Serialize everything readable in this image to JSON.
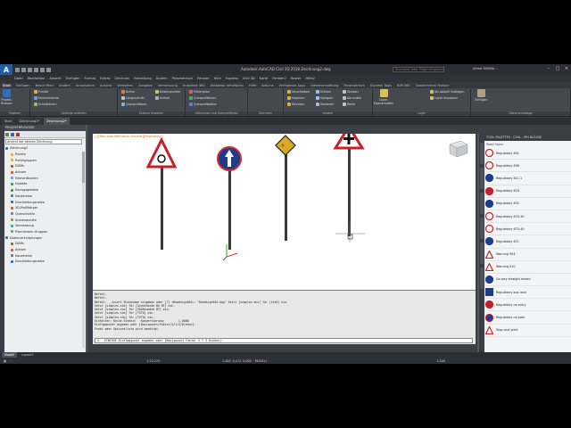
{
  "title": {
    "window": "Autodesk AutoCAD Civil 3D 2018    Zeichnung2.dwg",
    "search_placeholder": "Stichwort oder Frage eingeben",
    "user": "Alfred WEBINI..."
  },
  "menubar": [
    "Datei",
    "Bearbeiten",
    "Ansicht",
    "Einfügen",
    "Format",
    "Extras",
    "Zeichnen",
    "Bemaßung",
    "Ändern",
    "Parametrisch",
    "Fenster",
    "Hilfe",
    "Express",
    "Civil 3D",
    "Karte",
    "Fenster2",
    "Raster",
    "Hilfe2"
  ],
  "ribbon_tabs": [
    "Start",
    "Einfügen",
    "Beschriften",
    "Ändern",
    "Analysieren",
    "Ansicht",
    "Verwalten",
    "Ausgabe",
    "Vermessung",
    "Autodesk 360",
    "Autodesk InfraWorks",
    "Hilfe",
    "Add-ins",
    "Verfügbare Apps",
    "Datenverwaltung",
    "Parametrisch",
    "Express Tools",
    "BIM 360",
    "Geotechnical Module"
  ],
  "ribbon": {
    "prospector_btn": "Projekt-Browser",
    "palettes_group": "Paletten",
    "groups": [
      "Gelände erstellen",
      "Entwurf erstellen",
      "Höhenplan und Querprofilplan",
      "Zeichnen",
      "Ändern",
      "Layer",
      "Zwischenablage"
    ],
    "rows": [
      [
        "Punkte",
        "Elementkante",
        "Schnittlinien",
        "Achse",
        "Längsschnitt",
        "Querprofilplan",
        "Knotenpunkte",
        "Kreisel",
        "Höhenplan",
        "Querprofillinien",
        "Querprofilpläne"
      ],
      [
        "Verschieben",
        "Kopieren",
        "Strecken",
        "Drehen",
        "Spiegeln",
        "Skalieren",
        "Stutzen",
        "Abrunden",
        "Reihe"
      ]
    ],
    "layer_items": [
      "Als aktuell festlegen",
      "Layer anpassen"
    ],
    "paste": "Einfügen",
    "layer_props": "Layer-Eigenschaften"
  },
  "doc_tabs": [
    "Start",
    "Zeichnung1*",
    "Zeichnung2*"
  ],
  "prospector": {
    "header": "PROJEKTBROWSER",
    "select": "Ansicht der aktiven Zeichnung",
    "tree": [
      "Zeichnung2",
      "Punkte",
      "Punktgruppen",
      "DGMs",
      "Achsen",
      "Elementkanten",
      "Gebiete",
      "Einzugsgebiete",
      "Kanalnetze",
      "Druckleitungsnetze",
      "3D-Profilkörper",
      "Querschnitte",
      "Knotenpunkte",
      "Vermessung",
      "Planrahmen-Gruppen",
      "Datenverknüpfungen",
      "DGMs",
      "Achsen",
      "Kanalnetze",
      "Druckleitungsnetze"
    ]
  },
  "viewport": {
    "title": "[-][Benutzerdefinierte Ansicht][Realistisch]"
  },
  "command": {
    "lines": [
      "Befehl:",
      "Befehl:",
      "Befehl: _-insert Blockname eingeben oder [?] <Roadsign504>: \"Roadsign504.dwg\" Setzt [simplex.shx] für [txt0] ein.",
      "Setzt [simplex.shx] für [AvantGarde Bk BT] ein.",
      "Setzt [simplex.shx] für [VAGRounded BT] ein.",
      "Setzt [simplex.shx] für [TXTO] ein.",
      "Setzt [simplex.shx] für [TXT0] ein.",
      "Einheiten: Keine Einheit   Konvertierung:        1,0000",
      "Einfügepunkt angeben oder [Basispunkt/Faktor/X/Y/Z/Drehen]:",
      "Punkt oder Optionsliste wird benötigt."
    ],
    "input": "X- -EINFÜGE Einfügepunkt angeben oder [Basispunkt Faktor X Y Z Drehen]:"
  },
  "palette": {
    "header": "TOOL PALETTES - CIVIL - MH BLÖCKE",
    "section": "Road Signs",
    "items": [
      "Regulatory 601",
      "Regulatory 606",
      "Regulatory 611.1",
      "Regulatory 618",
      "Regulatory 632",
      "Regulatory 670-30",
      "Regulatory 670-40",
      "Regulatory 671",
      "Warning 904",
      "Warning 510",
      "Go way straight ahead",
      "Regulatory bus lane",
      "Regulatory no entry",
      "Regulatory no park",
      "Stop and yield"
    ]
  },
  "layout_tabs": [
    "Modell",
    "Layout1"
  ],
  "status": {
    "scale": "1:25.225",
    "coords": "2,000, 0,472, 0,000",
    "space": "MODELL",
    "zoom": "1:200"
  }
}
